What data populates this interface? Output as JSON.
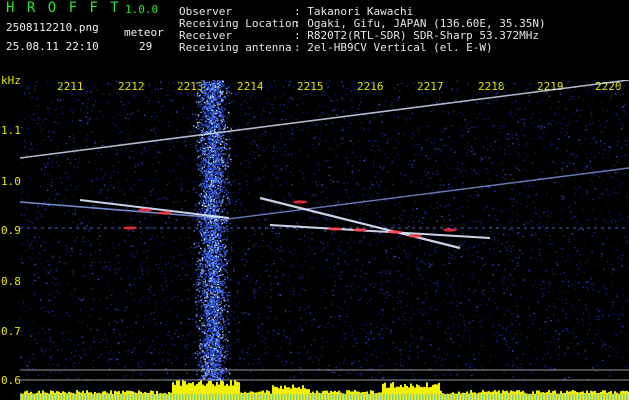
{
  "header": {
    "app_name": "H R O F F T",
    "version": "1.0.0",
    "filename": "2508112210.png",
    "datetime": "25.08.11 22:10",
    "meteor_label": "meteor",
    "meteor_count": "29"
  },
  "station": {
    "observer_label": "Observer",
    "observer_value": ": Takanori Kawachi",
    "location_label": "Receiving Location",
    "location_value": ": Ogaki, Gifu, JAPAN (136.60E, 35.35N)",
    "receiver_label": "Receiver",
    "receiver_value": ": R820T2(RTL-SDR) SDR-Sharp 53.372MHz",
    "antenna_label": "Receiving antenna",
    "antenna_value": ": 2el-HB9CV Vertical (el. E-W)"
  },
  "axis": {
    "unit": "kHz",
    "time_ticks": [
      "2211",
      "2212",
      "2213",
      "2214",
      "2215",
      "2216",
      "2217",
      "2218",
      "2219",
      "2220"
    ],
    "freq_ticks": [
      "1.1",
      "1.0",
      "0.9",
      "0.8",
      "0.7",
      "0.6"
    ]
  },
  "colors": {
    "background": "#000000",
    "noise_blue": "#1a2aa8",
    "trace_white": "#e0eaff",
    "label_yellow": "#e8e600",
    "title_green": "#2ee62e",
    "hot_red": "#ff3040",
    "bar_yellow": "#f2f200"
  }
}
